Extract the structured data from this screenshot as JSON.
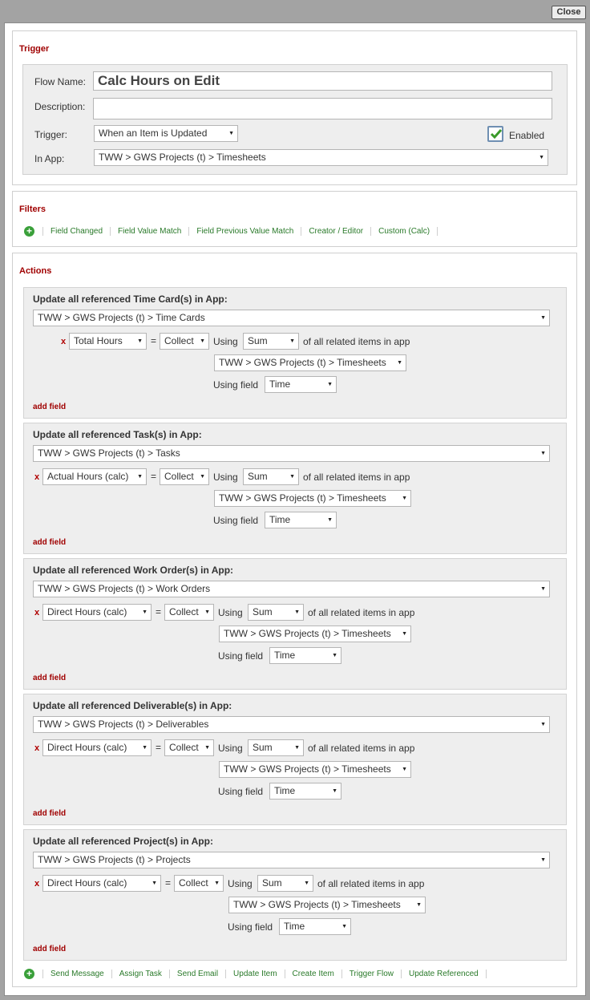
{
  "close_label": "Close",
  "trigger": {
    "title": "Trigger",
    "flow_name_label": "Flow Name:",
    "flow_name_value": "Calc Hours on Edit",
    "description_label": "Description:",
    "description_value": "",
    "trigger_label": "Trigger:",
    "trigger_value": "When an Item is Updated",
    "enabled_label": "Enabled",
    "enabled_checked": true,
    "in_app_label": "In App:",
    "in_app_value": "TWW > GWS Projects (t) > Timesheets"
  },
  "filters": {
    "title": "Filters",
    "links": [
      "Field Changed",
      "Field Value Match",
      "Field Previous Value Match",
      "Creator / Editor",
      "Custom (Calc)"
    ]
  },
  "actions": {
    "title": "Actions",
    "common": {
      "remove": "x",
      "equals": "=",
      "op_value": "Collect",
      "using_label": "Using",
      "agg_value": "Sum",
      "of_all_label": "of all related items in app",
      "related_app": "TWW > GWS Projects (t) > Timesheets",
      "using_field_label": "Using field",
      "source_field": "Time",
      "add_field_label": "add field"
    },
    "items": [
      {
        "title": "Update all referenced Time Card(s) in App:",
        "app": "TWW > GWS Projects (t) > Time Cards",
        "field": "Total Hours"
      },
      {
        "title": "Update all referenced Task(s) in App:",
        "app": "TWW > GWS Projects (t) > Tasks",
        "field": "Actual Hours (calc)"
      },
      {
        "title": "Update all referenced Work Order(s) in App:",
        "app": "TWW > GWS Projects (t) > Work Orders",
        "field": "Direct Hours (calc)"
      },
      {
        "title": "Update all referenced Deliverable(s) in App:",
        "app": "TWW > GWS Projects (t) > Deliverables",
        "field": "Direct Hours (calc)"
      },
      {
        "title": "Update all referenced Project(s) in App:",
        "app": "TWW > GWS Projects (t) > Projects",
        "field": "Direct Hours (calc)"
      }
    ],
    "links": [
      "Send Message",
      "Assign Task",
      "Send Email",
      "Update Item",
      "Create Item",
      "Trigger Flow",
      "Update Referenced"
    ]
  },
  "colors": {
    "title_red": "#a00000",
    "link_green": "#2a7a2a",
    "plus_green": "#3aa03a"
  }
}
